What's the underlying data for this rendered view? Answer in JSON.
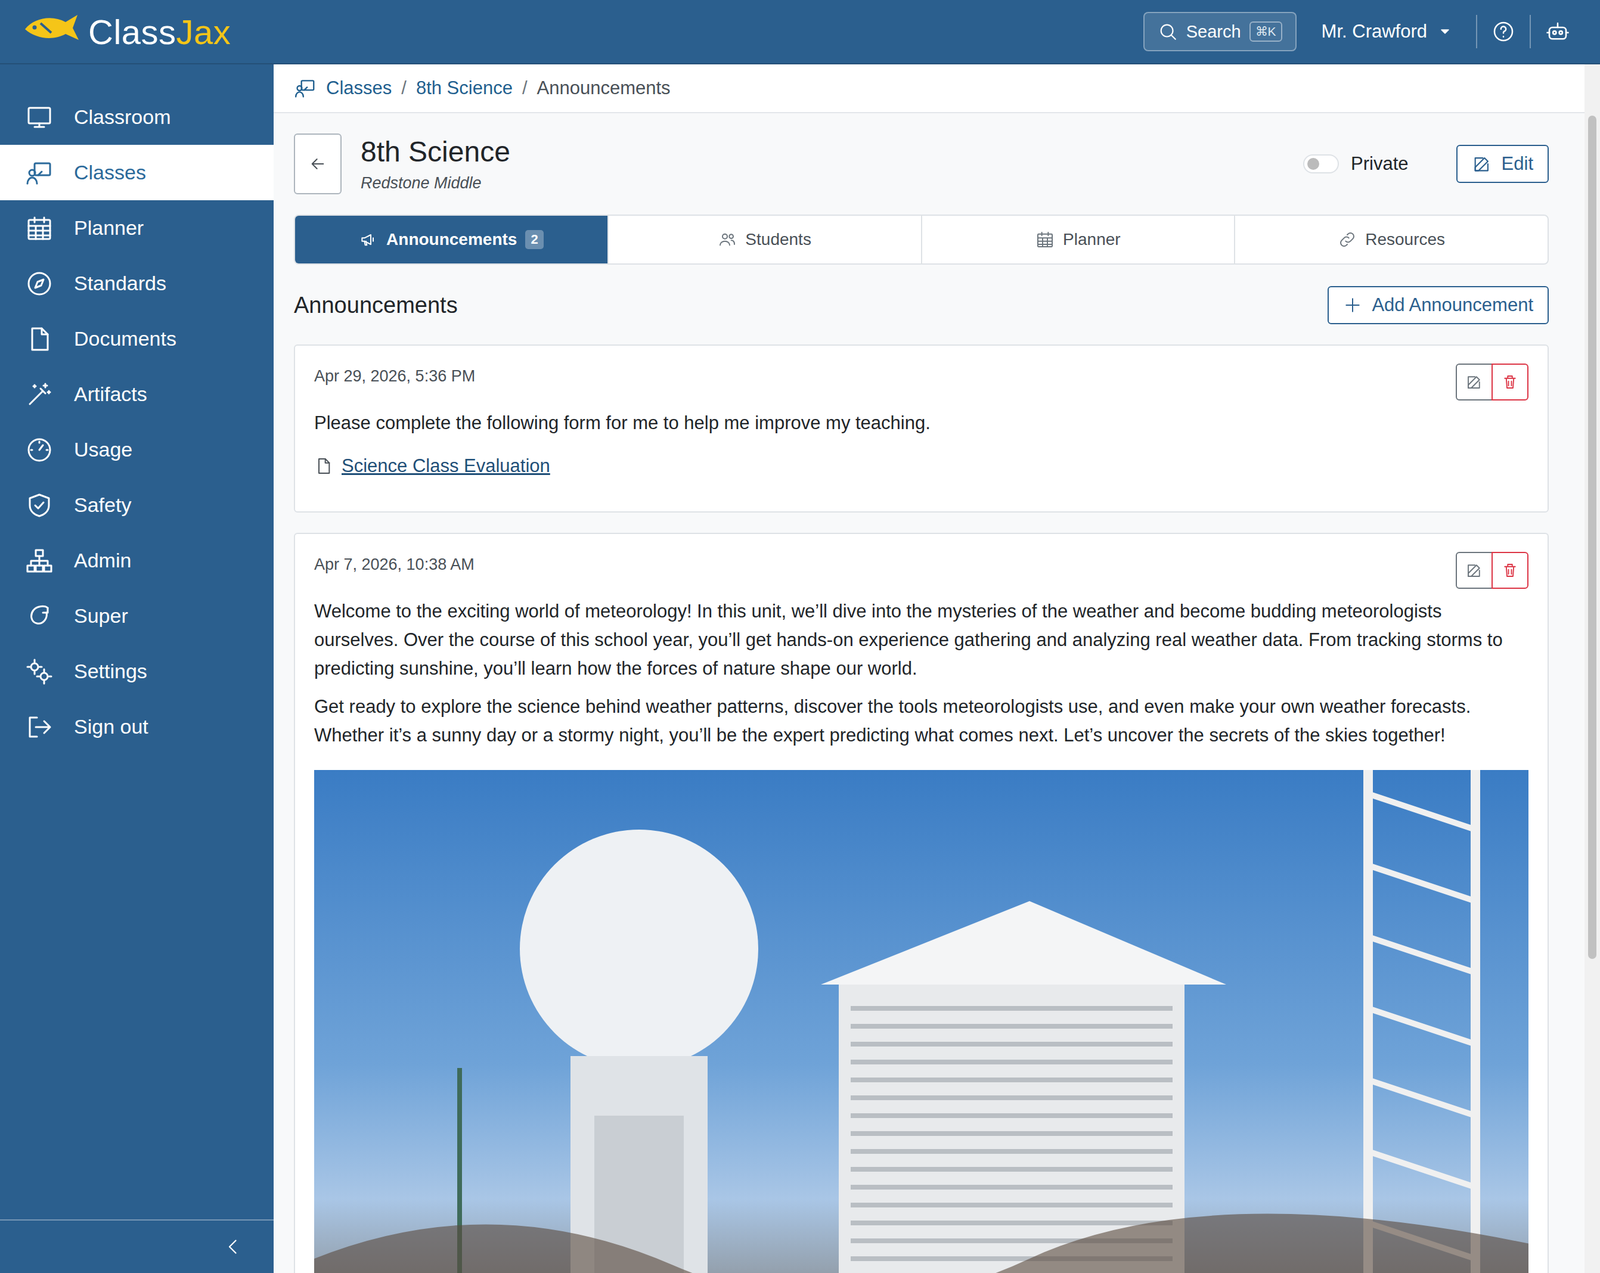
{
  "topbar": {
    "logo": {
      "first": "Class",
      "second": "Jax"
    },
    "search": {
      "label": "Search",
      "shortcut": "⌘K"
    },
    "user": "Mr. Crawford"
  },
  "sidebar": {
    "items": [
      {
        "label": "Classroom",
        "selected": false
      },
      {
        "label": "Classes",
        "selected": true
      },
      {
        "label": "Planner",
        "selected": false
      },
      {
        "label": "Standards",
        "selected": false
      },
      {
        "label": "Documents",
        "selected": false
      },
      {
        "label": "Artifacts",
        "selected": false
      },
      {
        "label": "Usage",
        "selected": false
      },
      {
        "label": "Safety",
        "selected": false
      },
      {
        "label": "Admin",
        "selected": false
      },
      {
        "label": "Super",
        "selected": false
      },
      {
        "label": "Settings",
        "selected": false
      },
      {
        "label": "Sign out",
        "selected": false
      }
    ]
  },
  "breadcrumb": [
    "Classes",
    "8th Science",
    "Announcements"
  ],
  "class": {
    "title": "8th Science",
    "school": "Redstone Middle",
    "private": {
      "label": "Private",
      "on": false
    },
    "edit": "Edit"
  },
  "tabs": [
    {
      "label": "Announcements",
      "badge": "2",
      "selected": true
    },
    {
      "label": "Students",
      "selected": false
    },
    {
      "label": "Planner",
      "selected": false
    },
    {
      "label": "Resources",
      "selected": false
    }
  ],
  "section": {
    "title": "Announcements",
    "add": "Add Announcement"
  },
  "announcements": [
    {
      "date": "Apr 29, 2026, 5:36 PM",
      "paragraphs": [
        "Please complete the following form for me to help me improve my teaching."
      ],
      "attachment": "Science Class Evaluation"
    },
    {
      "date": "Apr 7, 2026, 10:38 AM",
      "paragraphs": [
        "Welcome to the exciting world of meteorology! In this unit, we’ll dive into the mysteries of the weather and become budding meteorologists ourselves. Over the course of this school year, you’ll get hands-on experience gathering and analyzing real weather data. From tracking storms to predicting sunshine, you’ll learn how the forces of nature shape our world.",
        "Get ready to explore the science behind weather patterns, discover the tools meteorologists use, and even make your own weather forecasts. Whether it’s a sunny day or a stormy night, you’ll be the expert predicting what comes next. Let’s uncover the secrets of the skies together!"
      ],
      "image": true
    }
  ]
}
